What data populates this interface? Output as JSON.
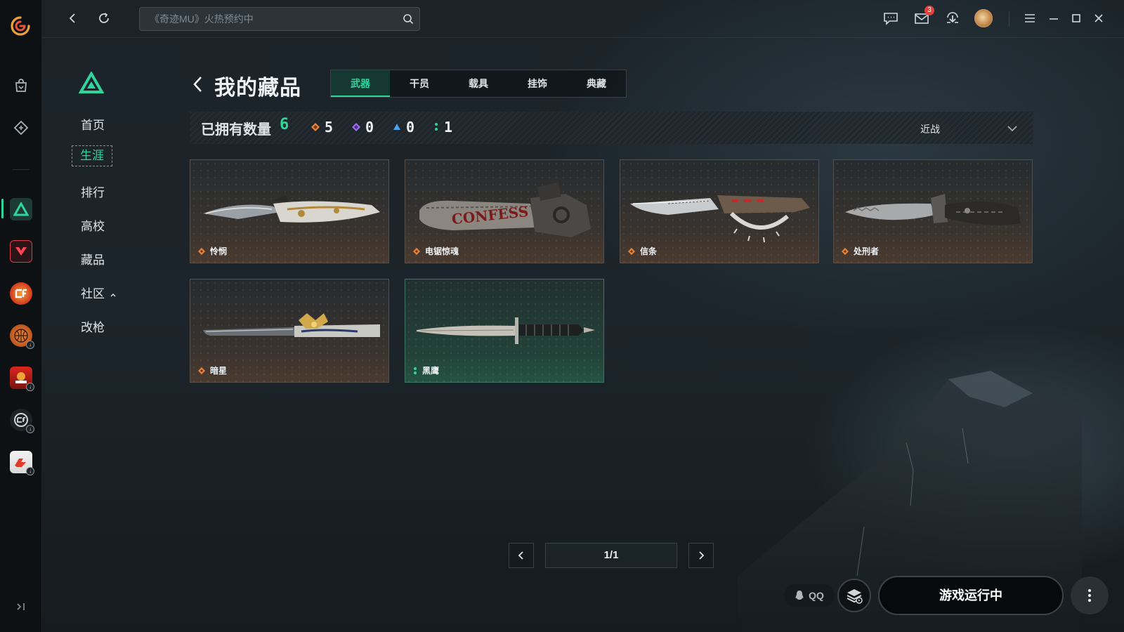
{
  "topbar": {
    "search_placeholder": "《奇迹MU》火热预约中",
    "mail_badge": "3"
  },
  "sidebar_nav": {
    "items": [
      {
        "label": "首页",
        "active": false
      },
      {
        "label": "生涯",
        "active": true
      },
      {
        "label": "排行",
        "active": false
      },
      {
        "label": "高校",
        "active": false
      },
      {
        "label": "藏品",
        "active": false
      },
      {
        "label": "社区",
        "active": false,
        "has_chevron": true
      },
      {
        "label": "改枪",
        "active": false
      }
    ]
  },
  "collection": {
    "title": "我的藏品",
    "tabs": [
      {
        "label": "武器",
        "active": true
      },
      {
        "label": "干员",
        "active": false
      },
      {
        "label": "载具",
        "active": false
      },
      {
        "label": "挂饰",
        "active": false
      },
      {
        "label": "典藏",
        "active": false
      }
    ],
    "summary": {
      "owned_label": "已拥有数量",
      "owned_count": "6",
      "rarity_counts": [
        {
          "rarity": "orange",
          "color": "#e8843a",
          "count": "5"
        },
        {
          "rarity": "purple",
          "color": "#9b6cf0",
          "count": "0"
        },
        {
          "rarity": "blue",
          "color": "#4aa3f0",
          "count": "0"
        },
        {
          "rarity": "green",
          "color": "#2fd59b",
          "count": "1"
        }
      ],
      "filter_label": "近战"
    },
    "items": [
      {
        "name": "怜悯",
        "rarity": "orange"
      },
      {
        "name": "电锯惊魂",
        "rarity": "orange"
      },
      {
        "name": "信条",
        "rarity": "orange"
      },
      {
        "name": "处刑者",
        "rarity": "orange"
      },
      {
        "name": "暗星",
        "rarity": "orange"
      },
      {
        "name": "黑鹰",
        "rarity": "green"
      }
    ]
  },
  "pagination": {
    "text": "1/1"
  },
  "bottom": {
    "qq_label": "QQ",
    "run_button": "游戏运行中"
  },
  "colors": {
    "accent": "#2fd59b",
    "orange": "#e8843a"
  }
}
